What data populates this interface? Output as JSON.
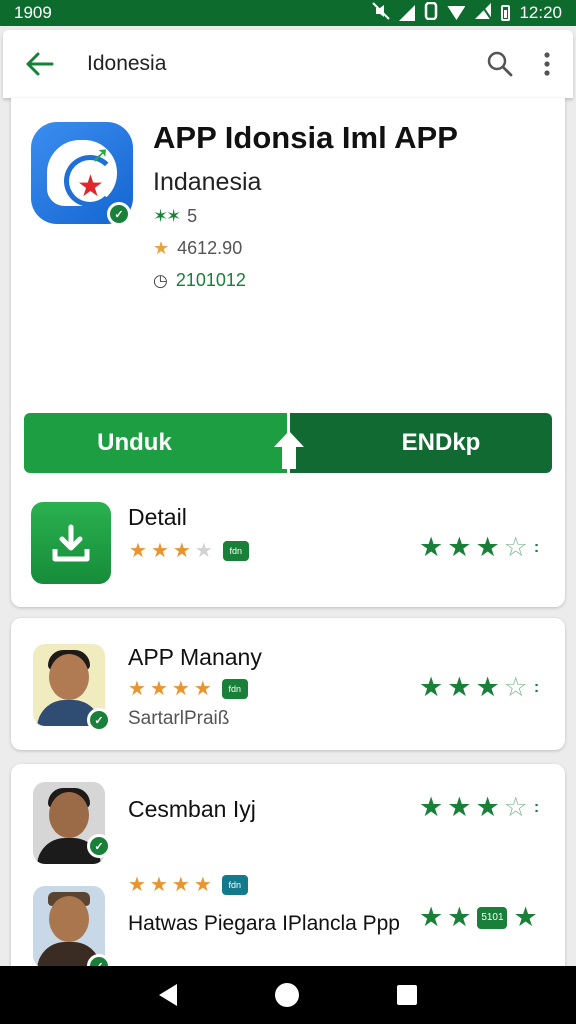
{
  "status_bar": {
    "time_left": "1909",
    "time_right": "12:20"
  },
  "app_bar": {
    "title": "Idonesia",
    "back_icon": "arrow-left-icon",
    "search_icon": "search-icon",
    "more_icon": "more-vert-icon"
  },
  "app": {
    "title": "APP Idonsia Iml APP",
    "developer": "Indanesia",
    "rating_value": "5",
    "downloads": "4612.90",
    "date": "2101012",
    "colors": {
      "primary_green": "#1e9e43",
      "dark_green": "#126a33",
      "icon_blue": "#1e6fd8"
    }
  },
  "buttons": {
    "install_label": "Unduk",
    "open_label": "ENDkp"
  },
  "rows": [
    {
      "title": "Detail",
      "stars_filled": 3,
      "stars_total": 4,
      "right_stars_filled": 3,
      "right_stars_total": 4
    },
    {
      "title": "APP Manany",
      "subtitle": "SartarlPraiß",
      "stars_filled": 4,
      "stars_total": 4,
      "right_stars_filled": 3,
      "right_stars_total": 4
    },
    {
      "title": "Cesmban Iyj",
      "right_stars_filled": 3,
      "right_stars_total": 4
    },
    {
      "title": "Hatwas Piegara IPlancla Ppp",
      "stars_filled": 4,
      "stars_total": 4,
      "badge_text": "5101"
    }
  ],
  "nav_bar": {
    "back_icon": "nav-back-icon",
    "home_icon": "nav-home-icon",
    "recents_icon": "nav-recents-icon"
  }
}
